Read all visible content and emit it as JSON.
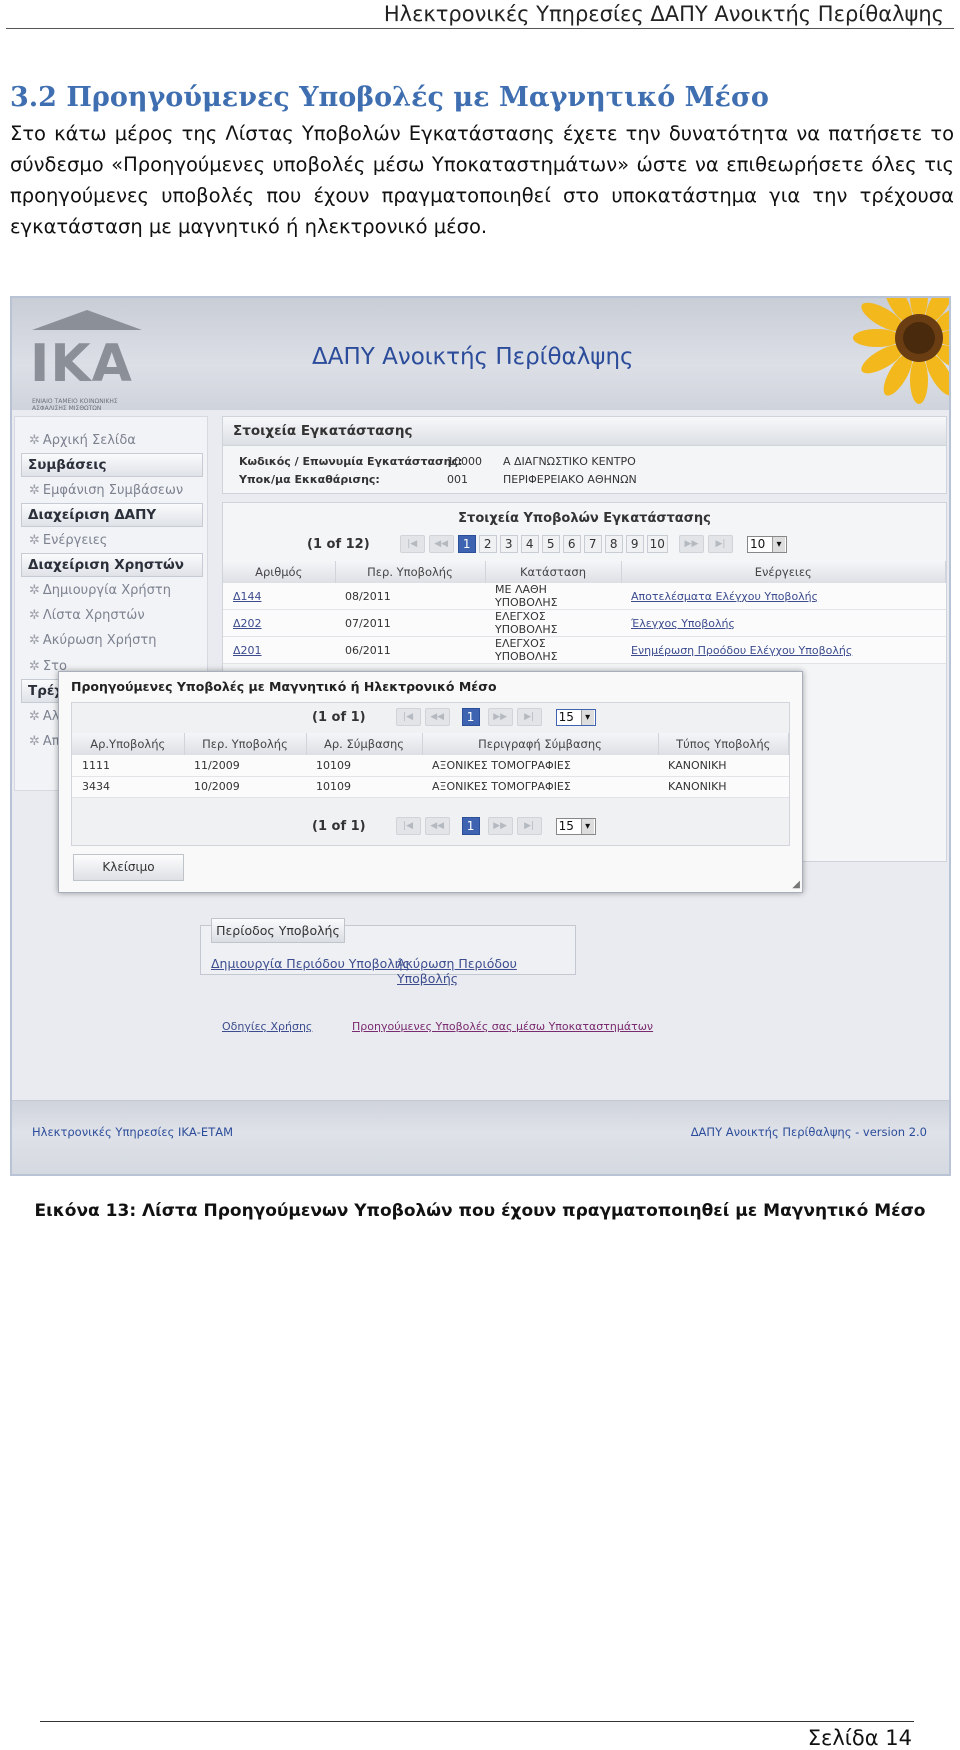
{
  "document": {
    "running_header": "Ηλεκτρονικές Υπηρεσίες ΔΑΠΥ Ανοικτής Περίθαλψης",
    "section_heading": "3.2 Προηγούμενες Υποβολές με Μαγνητικό Μέσο",
    "paragraph": "Στο κάτω μέρος της Λίστας Υποβολών Εγκατάστασης έχετε την δυνατότητα να πατήσετε το σύνδεσμο «Προηγούμενες υποβολές μέσω Υποκαταστημάτων» ώστε να επιθεωρήσετε όλες τις προηγούμενες υποβολές που έχουν πραγματοποιηθεί στο υποκατάστημα για την τρέχουσα εγκατάσταση με μαγνητικό ή ηλεκτρονικό μέσο.",
    "caption": "Εικόνα 13: Λίστα Προηγούμενων Υποβολών που έχουν πραγματοποιηθεί με Μαγνητικό Μέσο",
    "page_number": "Σελίδα 14"
  },
  "screenshot": {
    "logo_text": "IKA",
    "logo_subtext": "ΕΝΙΑΙΟ ΤΑΜΕΙΟ ΚΟΙΝΩΝΙΚΗΣ ΑΣΦΑΛΙΣΗΣ ΜΙΣΘΩΤΩΝ",
    "banner_title": "ΔΑΠΥ Ανοικτής Περίθαλψης",
    "sidebar": {
      "home": "Αρχική Σελίδα",
      "contracts_group": "Συμβάσεις",
      "show_contracts": "Εμφάνιση Συμβάσεων",
      "dapy_group": "Διαχείριση ΔΑΠΥ",
      "actions": "Ενέργειες",
      "users_group": "Διαχείριση Χρηστών",
      "create_user": "Δημιουργία Χρήστη",
      "user_list": "Λίστα Χρηστών",
      "cancel_user": "Ακύρωση Χρήστη",
      "partial_1": "Στο",
      "partial_group": "Τρέχ",
      "partial_2": "Αλλ",
      "partial_3": "Απο"
    },
    "facility": {
      "title": "Στοιχεία Εγκατάστασης",
      "code_label": "Κωδικός / Επωνυμία Εγκατάστασης:",
      "code_value": "10000",
      "name_value": "Α ΔΙΑΓΝΩΣΤΙΚΟ ΚΕΝΤΡΟ",
      "branch_label": "Υποκ/μα Εκκαθάρισης:",
      "branch_code": "001",
      "branch_name": "ΠΕΡΙΦΕΡΕΙΑΚΟ ΑΘΗΝΩΝ"
    },
    "submissions": {
      "title": "Στοιχεία Υποβολών Εγκατάστασης",
      "pager_info": "(1 of 12)",
      "pages": [
        "1",
        "2",
        "3",
        "4",
        "5",
        "6",
        "7",
        "8",
        "9",
        "10"
      ],
      "page_size": "10",
      "columns": [
        "Αριθμός",
        "Περ. Υποβολής",
        "Κατάσταση",
        "Ενέργειες"
      ],
      "rows": [
        [
          "Δ144",
          "08/2011",
          "ΜΕ ΛΑΘΗ ΥΠΟΒΟΛΗΣ",
          "Αποτελέσματα Ελέγχου Υποβολής"
        ],
        [
          "Δ202",
          "07/2011",
          "ΕΛΕΓΧΟΣ ΥΠΟΒΟΛΗΣ",
          "Έλεγχος Υποβολής"
        ],
        [
          "Δ201",
          "06/2011",
          "ΕΛΕΓΧΟΣ ΥΠΟΒΟΛΗΣ",
          "Ενημέρωση Προόδου Ελέγχου Υποβολής"
        ]
      ]
    },
    "modal": {
      "title": "Προηγούμενες Υποβολές με Μαγνητικό ή Ηλεκτρονικό Μέσο",
      "pager_info": "(1 of 1)",
      "page": "1",
      "page_size": "15",
      "columns": [
        "Αρ.Υποβολής",
        "Περ. Υποβολής",
        "Αρ. Σύμβασης",
        "Περιγραφή Σύμβασης",
        "Τύπος Υποβολής"
      ],
      "rows": [
        [
          "1111",
          "11/2009",
          "10109",
          "ΑΞΟΝΙΚΕΣ ΤΟΜΟΓΡΑΦΙΕΣ",
          "ΚΑΝΟΝΙΚΗ"
        ],
        [
          "3434",
          "10/2009",
          "10109",
          "ΑΞΟΝΙΚΕΣ ΤΟΜΟΓΡΑΦΙΕΣ",
          "ΚΑΝΟΝΙΚΗ"
        ]
      ],
      "close_label": "Κλείσιμο"
    },
    "period": {
      "button": "Περίοδος Υποβολής",
      "create_link": "Δημιουργία Περιόδου Υποβολής",
      "cancel_link": "Ακύρωση Περιόδου Υποβολής"
    },
    "links": {
      "instructions": "Οδηγίες Χρήσης",
      "previous_submissions": "Προηγούμενες Υποβολές σας μέσω Υποκαταστημάτων"
    },
    "footer": {
      "left": "Ηλεκτρονικές Υπηρεσίες ΙΚΑ-ΕΤΑΜ",
      "right": "ΔΑΠΥ Ανοικτής Περίθαλψης - version 2.0"
    }
  }
}
